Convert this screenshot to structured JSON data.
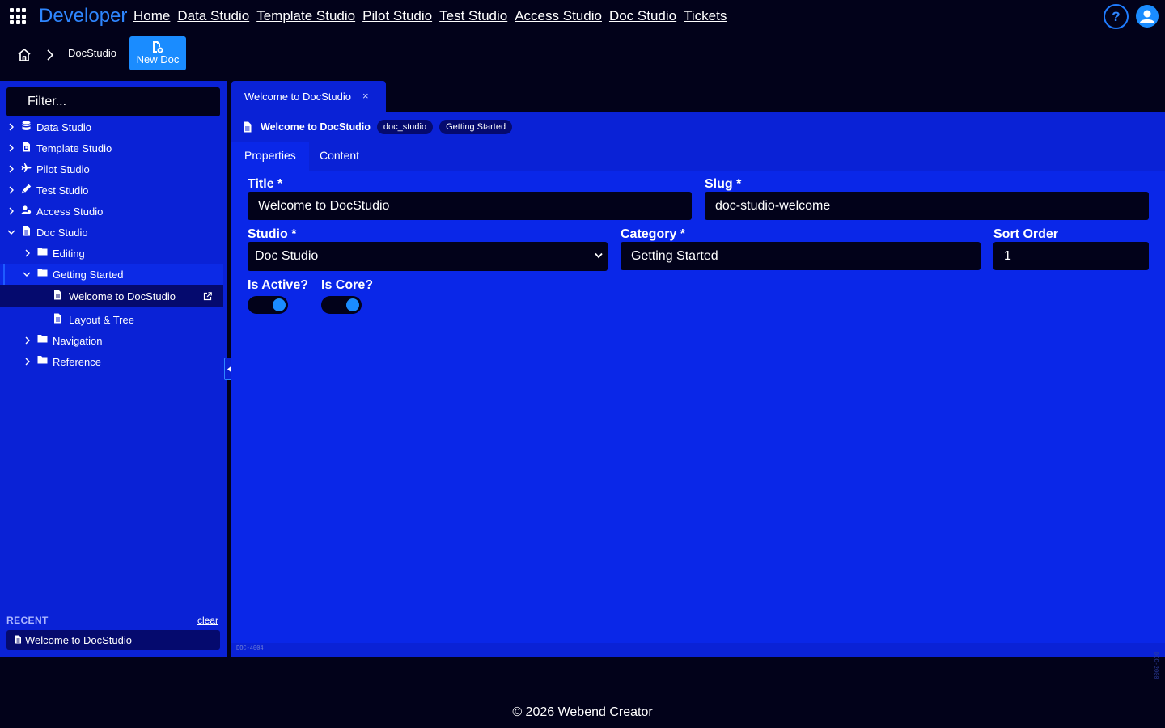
{
  "header": {
    "brand": "Developer",
    "nav": [
      "Home",
      "Data Studio",
      "Template Studio",
      "Pilot Studio",
      "Test Studio",
      "Access Studio",
      "Doc Studio",
      "Tickets"
    ],
    "help_label": "?"
  },
  "breadcrumb": {
    "current": "DocStudio",
    "new_doc_label": "New Doc"
  },
  "sidebar": {
    "filter_placeholder": "Filter...",
    "tree": [
      {
        "label": "Data Studio",
        "icon": "database-icon",
        "expanded": false
      },
      {
        "label": "Template Studio",
        "icon": "template-icon",
        "expanded": false
      },
      {
        "label": "Pilot Studio",
        "icon": "plane-icon",
        "expanded": false
      },
      {
        "label": "Test Studio",
        "icon": "pen-icon",
        "expanded": false
      },
      {
        "label": "Access Studio",
        "icon": "users-icon",
        "expanded": false
      },
      {
        "label": "Doc Studio",
        "icon": "document-icon",
        "expanded": true
      },
      {
        "label": "Editing",
        "icon": "folder-icon",
        "expanded": false
      },
      {
        "label": "Getting Started",
        "icon": "folder-icon",
        "expanded": true
      },
      {
        "label": "Welcome to DocStudio",
        "icon": "document-icon",
        "active": true
      },
      {
        "label": "Layout & Tree",
        "icon": "document-icon"
      },
      {
        "label": "Navigation",
        "icon": "folder-icon",
        "expanded": false
      },
      {
        "label": "Reference",
        "icon": "folder-icon",
        "expanded": false
      }
    ],
    "recent_title": "RECENT",
    "recent_clear": "clear",
    "recent_items": [
      "Welcome to DocStudio"
    ]
  },
  "editor": {
    "tab_label": "Welcome to DocStudio",
    "tab_close": "×",
    "doc_title": "Welcome to DocStudio",
    "badges": [
      "doc_studio",
      "Getting Started"
    ],
    "subtabs": [
      "Properties",
      "Content"
    ],
    "active_subtab": "Properties",
    "fields": {
      "title_label": "Title *",
      "title_value": "Welcome to DocStudio",
      "slug_label": "Slug *",
      "slug_value": "doc-studio-welcome",
      "studio_label": "Studio *",
      "studio_value": "Doc Studio",
      "category_label": "Category *",
      "category_value": "Getting Started",
      "sort_label": "Sort Order",
      "sort_value": "1",
      "active_label": "Is Active?",
      "active_value": true,
      "core_label": "Is Core?",
      "core_value": true
    },
    "code_tag": "DOC-4004",
    "side_code": "DOC-2000"
  },
  "footer": {
    "text": "© 2026 Webend Creator"
  },
  "colors": {
    "background": "#02021a",
    "panel": "#0a22d6",
    "accent": "#1a8cff",
    "brand": "#2e86ff"
  }
}
